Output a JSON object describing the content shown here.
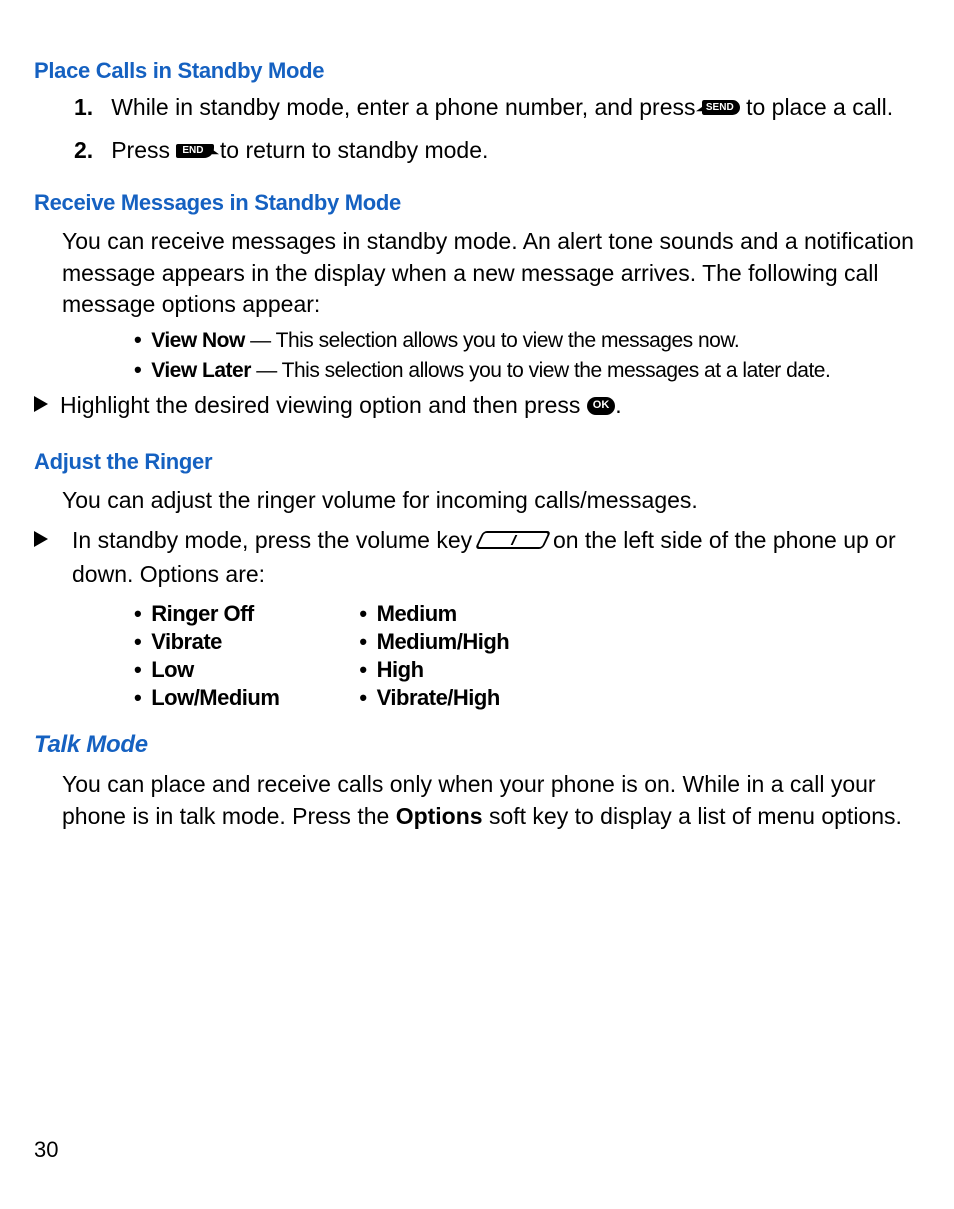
{
  "headings": {
    "place_calls": "Place Calls in Standby Mode",
    "receive_msgs": "Receive Messages in Standby Mode",
    "adjust_ringer": "Adjust the Ringer",
    "talk_mode": "Talk Mode"
  },
  "steps": {
    "s1_num": "1.",
    "s1a": "While in standby mode, enter a phone number, and press ",
    "s1b": " to place a call.",
    "s2_num": "2.",
    "s2a": "Press ",
    "s2b": " to return to standby mode."
  },
  "receive": {
    "para": "You can receive messages in standby mode. An alert tone sounds and a notification message appears in the display when a new message arrives. The following call message options appear:",
    "view_now_label": "View Now",
    "view_now_desc": " — This selection allows you to view the messages now.",
    "view_later_label": "View Later",
    "view_later_desc": " — This selection allows you to view the messages at a later date.",
    "arrow_a": "Highlight the desired viewing option and then press ",
    "arrow_b": "."
  },
  "ringer": {
    "para": "You can adjust the ringer volume for incoming calls/messages.",
    "arrow_a": "In standby mode, press the volume key ",
    "arrow_b": " on the left side of the phone up or down. Options are:",
    "col1": [
      "Ringer Off",
      "Vibrate",
      "Low",
      "Low/Medium"
    ],
    "col2": [
      "Medium",
      "Medium/High",
      "High",
      "Vibrate/High"
    ]
  },
  "talk": {
    "para_a": "You can place and receive calls only when your phone is on. While in a call your phone is in talk mode. Press the ",
    "options_word": "Options",
    "para_b": " soft key to display a list of menu options."
  },
  "keys": {
    "send": "SEND",
    "end": "END",
    "ok": "OK"
  },
  "page_number": "30"
}
